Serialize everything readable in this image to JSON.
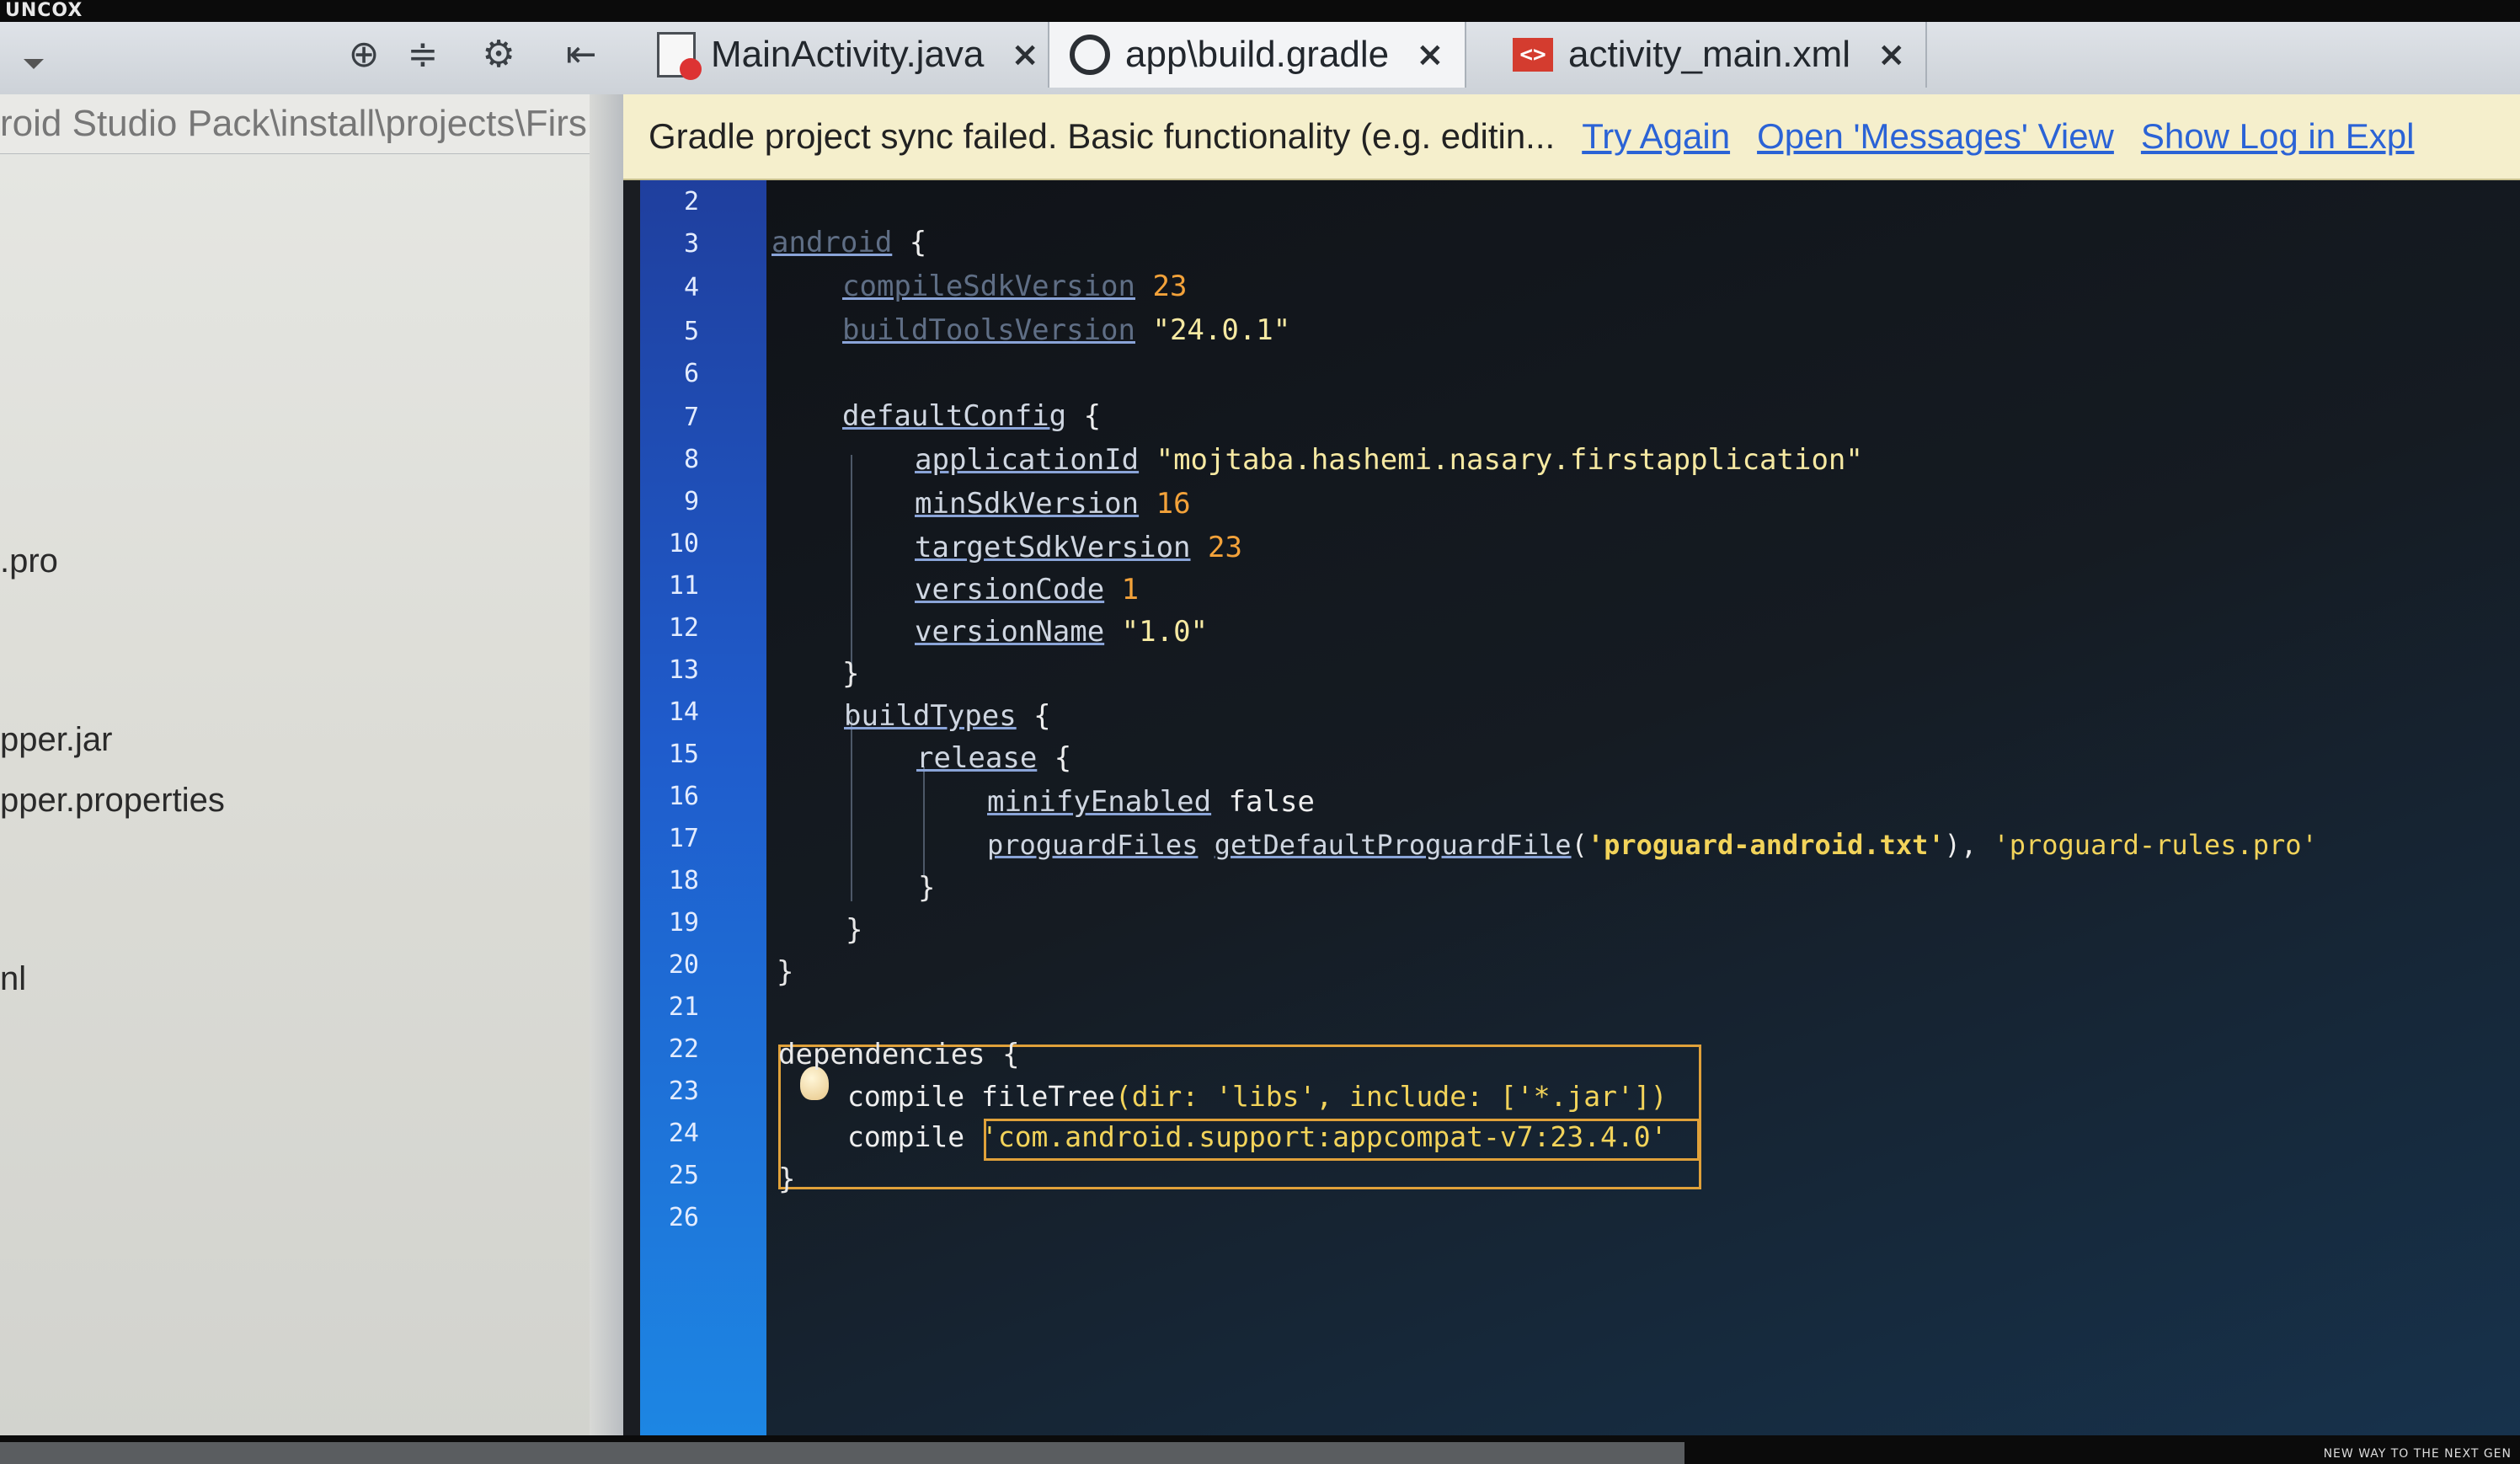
{
  "watermark": "UNCOX",
  "tagline": "NEW WAY TO THE NEXT GEN",
  "tabs": [
    {
      "label": "MainActivity.java",
      "close": "×"
    },
    {
      "label": "app\\build.gradle",
      "close": "×"
    },
    {
      "label": "activity_main.xml",
      "close": "×"
    }
  ],
  "toolbar_icons": [
    "crosshair-icon",
    "collapse-icon",
    "gear-icon",
    "pin-icon"
  ],
  "project_panel": {
    "path": "roid Studio Pack\\install\\projects\\Firs",
    "items": [
      ".pro",
      "pper.jar",
      "pper.properties",
      "nl"
    ]
  },
  "notification": {
    "message": "Gradle project sync failed. Basic functionality (e.g. editin...",
    "links": [
      "Try Again",
      "Open 'Messages' View",
      "Show Log in Expl"
    ]
  },
  "line_numbers": [
    "2",
    "3",
    "4",
    "5",
    "6",
    "7",
    "8",
    "9",
    "10",
    "11",
    "12",
    "13",
    "14",
    "15",
    "16",
    "17",
    "18",
    "19",
    "20",
    "21",
    "22",
    "23",
    "24",
    "25",
    "26"
  ],
  "code": {
    "l3_kw": "android",
    "l3_rest": " {",
    "l4_kw": "compileSdkVersion",
    "l4_val": "23",
    "l5_kw": "buildToolsVersion",
    "l5_val": "\"24.0.1\"",
    "l7_kw": "defaultConfig",
    "l7_rest": " {",
    "l8_kw": "applicationId",
    "l8_val": "\"mojtaba.hashemi.nasary.firstapplication\"",
    "l9_kw": "minSdkVersion",
    "l9_val": "16",
    "l10_kw": "targetSdkVersion",
    "l10_val": "23",
    "l11_kw": "versionCode",
    "l11_val": "1",
    "l12_kw": "versionName",
    "l12_val": "\"1.0\"",
    "l13": "}",
    "l14_kw": "buildTypes",
    "l14_rest": " {",
    "l15_kw": "release",
    "l15_rest": " {",
    "l16_kw": "minifyEnabled",
    "l16_val": " false",
    "l17_kw": "proguardFiles",
    "l17_fn": "getDefaultProguardFile",
    "l17_arg": "'proguard-android.txt'",
    "l17_sep": "), ",
    "l17_arg2": "'proguard-rules.pro'",
    "l18": "}",
    "l19": "}",
    "l20": "}",
    "l22": "dependencies {",
    "l23_kw": "compile",
    "l23_fn": "fileTree",
    "l23_args": "(dir: 'libs', include: ['*.jar'])",
    "l24_kw": "compile",
    "l24_val": "'com.android.support:appcompat-v7:23.4.0'",
    "l25": "}"
  }
}
